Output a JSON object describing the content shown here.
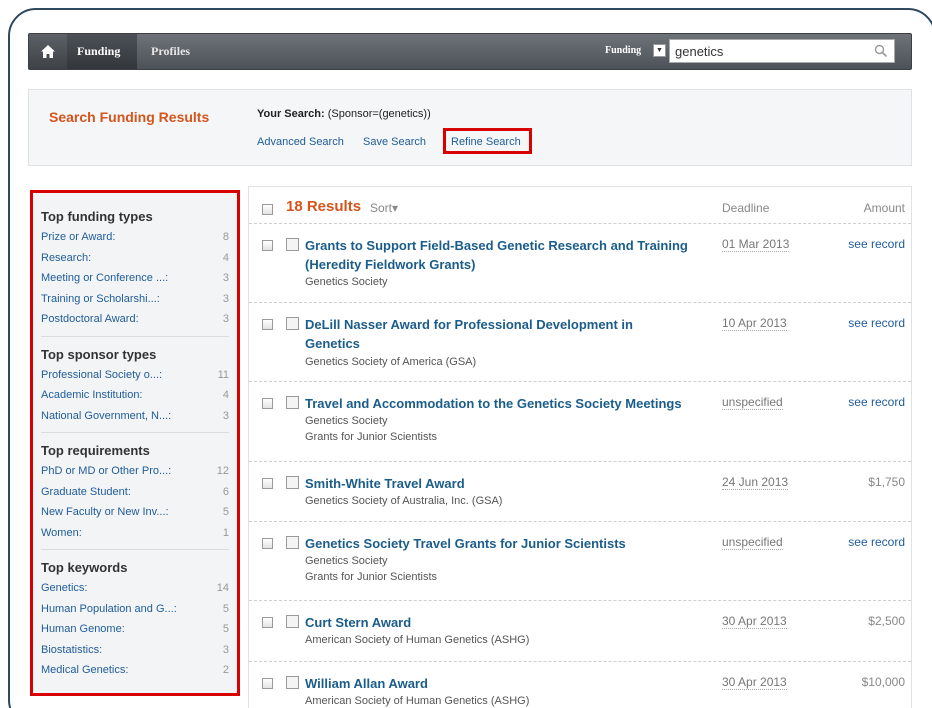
{
  "nav": {
    "home_icon": "home-icon",
    "items": [
      {
        "label": "Funding"
      },
      {
        "label": "Profiles"
      }
    ],
    "search_scope": "Funding",
    "search_value": "genetics",
    "search_icon": "magnifier-icon"
  },
  "header": {
    "title": "Search Funding Results",
    "your_search_label": "Your Search:",
    "your_search_query": "(Sponsor=(genetics))",
    "links": {
      "advanced": "Advanced Search",
      "save": "Save Search",
      "refine": "Refine Search"
    }
  },
  "sidebar": {
    "groups": [
      {
        "title": "Top funding types",
        "items": [
          {
            "label": "Prize or Award:",
            "count": "8"
          },
          {
            "label": "Research:",
            "count": "4"
          },
          {
            "label": "Meeting or Conference ...:",
            "count": "3"
          },
          {
            "label": "Training or Scholarshi...:",
            "count": "3"
          },
          {
            "label": "Postdoctoral Award:",
            "count": "3"
          }
        ]
      },
      {
        "title": "Top sponsor types",
        "items": [
          {
            "label": "Professional Society o...:",
            "count": "11"
          },
          {
            "label": "Academic Institution:",
            "count": "4"
          },
          {
            "label": "National Government, N...:",
            "count": "3"
          }
        ]
      },
      {
        "title": "Top requirements",
        "items": [
          {
            "label": "PhD or MD or Other Pro...:",
            "count": "12"
          },
          {
            "label": "Graduate Student:",
            "count": "6"
          },
          {
            "label": "New Faculty or New Inv...:",
            "count": "5"
          },
          {
            "label": "Women:",
            "count": "1"
          }
        ]
      },
      {
        "title": "Top keywords",
        "items": [
          {
            "label": "Genetics:",
            "count": "14"
          },
          {
            "label": "Human Population and G...:",
            "count": "5"
          },
          {
            "label": "Human Genome:",
            "count": "5"
          },
          {
            "label": "Biostatistics:",
            "count": "3"
          },
          {
            "label": "Medical Genetics:",
            "count": "2"
          }
        ]
      }
    ]
  },
  "results": {
    "count_label": "18 Results",
    "sort_label": "Sort▾",
    "col_deadline": "Deadline",
    "col_amount": "Amount",
    "rows": [
      {
        "title": "Grants to Support Field-Based Genetic Research and Training (Heredity Fieldwork Grants)",
        "sponsor": "Genetics Society",
        "program": "",
        "deadline": "01 Mar 2013",
        "amount": "see record"
      },
      {
        "title": "DeLill Nasser Award for Professional Development in Genetics",
        "sponsor": "Genetics Society of America (GSA)",
        "program": "",
        "deadline": "10 Apr 2013",
        "amount": "see record"
      },
      {
        "title": "Travel and Accommodation to the Genetics Society Meetings",
        "sponsor": "Genetics Society",
        "program": "Grants for Junior Scientists",
        "deadline": "unspecified",
        "amount": "see record"
      },
      {
        "title": "Smith-White Travel Award",
        "sponsor": "Genetics Society of Australia, Inc. (GSA)",
        "program": "",
        "deadline": "24 Jun 2013",
        "amount": "$1,750"
      },
      {
        "title": "Genetics Society Travel Grants for Junior Scientists",
        "sponsor": "Genetics Society",
        "program": "Grants for Junior Scientists",
        "deadline": "unspecified",
        "amount": "see record"
      },
      {
        "title": "Curt Stern Award",
        "sponsor": "American Society of Human Genetics (ASHG)",
        "program": "",
        "deadline": "30 Apr 2013",
        "amount": "$2,500"
      },
      {
        "title": "William Allan Award",
        "sponsor": "American Society of Human Genetics (ASHG)",
        "program": "",
        "deadline": "30 Apr 2013",
        "amount": "$10,000"
      }
    ]
  }
}
